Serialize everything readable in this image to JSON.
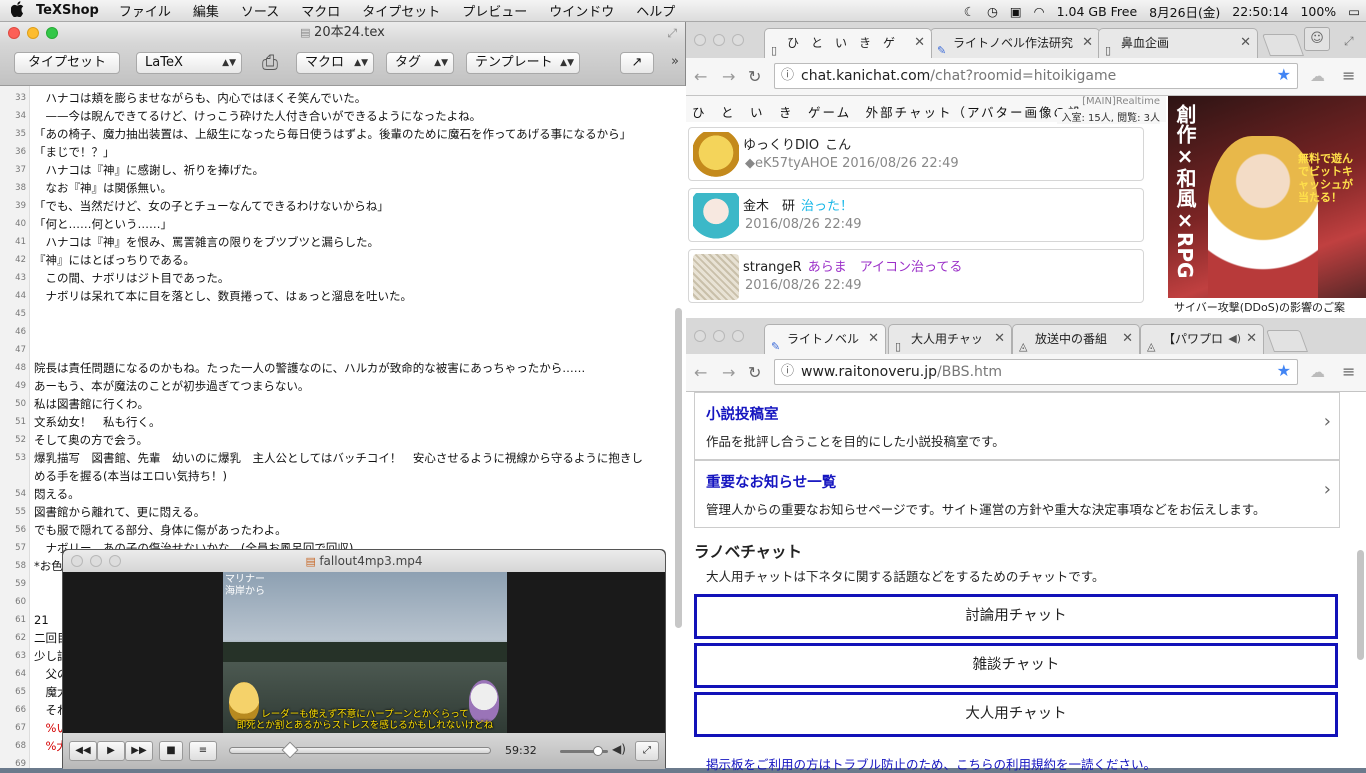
{
  "menubar": {
    "app_name": "TeXShop",
    "items": [
      "ファイル",
      "編集",
      "ソース",
      "マクロ",
      "タイプセット",
      "プレビュー",
      "ウインドウ",
      "ヘルプ"
    ],
    "disk_free": "1.04 GB Free",
    "date": "8月26日(金)",
    "time": "22:50:14",
    "battery": "100%"
  },
  "texshop": {
    "window_title": "20本24.tex",
    "toolbar": {
      "typeset_label": "タイプセット",
      "engine_value": "LaTeX",
      "macro_label": "マクロ",
      "tag_label": "タグ",
      "template_label": "テンプレート"
    },
    "lines": [
      {
        "num": "33",
        "text": "　ハナコは頬を膨らませながらも、内心ではほくそ笑んでいた。"
      },
      {
        "num": "34",
        "text": "　——今は睨んできてるけど、けっこう砕けた人付き合いができるようになったよね。"
      },
      {
        "num": "35",
        "text": "「あの椅子、魔力抽出装置は、上級生になったら毎日使うはずよ。後輩のために魔石を作ってあげる事になるから」"
      },
      {
        "num": "36",
        "text": "「まじで！？」"
      },
      {
        "num": "37",
        "text": "　ハナコは『神』に感謝し、祈りを捧げた。"
      },
      {
        "num": "38",
        "text": "　なお『神』は関係無い。"
      },
      {
        "num": "39",
        "text": "「でも、当然だけど、女の子とチューなんてできるわけないからね」"
      },
      {
        "num": "40",
        "text": "「何と……何という……」"
      },
      {
        "num": "41",
        "text": "　ハナコは『神』を恨み、罵詈雑言の限りをブツブツと漏らした。"
      },
      {
        "num": "42",
        "text": "『神』にはとばっちりである。"
      },
      {
        "num": "43",
        "text": "　この間、ナボリはジト目であった。"
      },
      {
        "num": "44",
        "text": "　ナボリは呆れて本に目を落とし、数頁捲って、はぁっと溜息を吐いた。"
      },
      {
        "num": "45",
        "text": ""
      },
      {
        "num": "46",
        "text": ""
      },
      {
        "num": "47",
        "text": ""
      },
      {
        "num": "48",
        "text": "院長は責任問題になるのかもね。たった一人の警護なのに、ハルカが致命的な被害にあっちゃったから……"
      },
      {
        "num": "49",
        "text": "あーもう、本が魔法のことが初歩過ぎてつまらない。"
      },
      {
        "num": "50",
        "text": "私は図書館に行くわ。"
      },
      {
        "num": "51",
        "text": "文系幼女！　私も行く。"
      },
      {
        "num": "52",
        "text": "そして奥の方で会う。"
      },
      {
        "num": "53",
        "text": "爆乳描写　図書館、先輩　幼いのに爆乳　主人公としてはバッチコイ！　安心させるように視線から守るように抱きし"
      },
      {
        "num": "",
        "text": "める手を握る(本当はエロい気持ち！)"
      },
      {
        "num": "54",
        "text": "悶える。"
      },
      {
        "num": "55",
        "text": "図書館から離れて、更に悶える。"
      },
      {
        "num": "56",
        "text": "でも服で隠れてる部分、身体に傷があったわよ。"
      },
      {
        "num": "57",
        "text": "　ナボリー。あの子の傷治せないかな。(全員お風呂回で回収)"
      },
      {
        "num": "58",
        "text": "*お色気を説明を一気にやる"
      },
      {
        "num": "59",
        "text": ""
      },
      {
        "num": "60",
        "text": ""
      },
      {
        "num": "61",
        "text": "21"
      },
      {
        "num": "62",
        "text": "二回目"
      },
      {
        "num": "63",
        "text": "少し話"
      },
      {
        "num": "64",
        "text": "　父の"
      },
      {
        "num": "65",
        "text": "　魔大"
      },
      {
        "num": "66",
        "text": "　それ"
      },
      {
        "num": "67",
        "text": "　%い",
        "red": true
      },
      {
        "num": "68",
        "text": "　%大",
        "red": true
      },
      {
        "num": "69",
        "text": ""
      },
      {
        "num": "70",
        "text": "魔物"
      }
    ]
  },
  "player": {
    "title": "fallout4mp3.mp4",
    "overlay_top": "マリナー海岸から",
    "subtitle_1": "レーダーも使えず不意にハープーンとかぐらって",
    "subtitle_2": "即死とか割とあるからストレスを感じるかもしれないけどね",
    "position": 0.23,
    "time": "59:32",
    "volume": 0.8
  },
  "chat_window": {
    "tabs": [
      {
        "label": "ひ　と　い　き　ゲ",
        "active": true
      },
      {
        "label": "ライトノベル作法研究",
        "active": false
      },
      {
        "label": "鼻血企画",
        "active": false
      }
    ],
    "url_host": "chat.kanichat.com",
    "url_path": "/chat?roomid=hitoikigame",
    "header_title": "ひ　と　い　き　ゲーム　外部チャット（アバター画像の設",
    "header_room": "[MAIN]Realtime",
    "header_count": "入室: 15人, 閲覧: 3人",
    "messages": [
      {
        "name": "ゆっくりDIO",
        "text": "こん",
        "text_color": "#222222",
        "meta": "◆eK57tyAHOE 2016/08/26 22:49"
      },
      {
        "name": "金木　研",
        "text": "治った！",
        "text_color": "#1ab8e8",
        "meta": "2016/08/26 22:49"
      },
      {
        "name": "strangeR",
        "text": "あらま　アイコン治ってる",
        "text_color": "#9b30c8",
        "meta": "2016/08/26 22:49"
      }
    ],
    "ad_title": "創作×和風×RPG",
    "ad_sub": "無料で遊んでビットキャッシュが当たる！",
    "news_snippet": "サイバー攻撃(DDoS)の影響のご案"
  },
  "novel_window": {
    "tabs": [
      {
        "label": "ライトノベル",
        "active": true
      },
      {
        "label": "大人用チャッ",
        "active": false
      },
      {
        "label": "放送中の番組",
        "active": false
      },
      {
        "label": "【パワプロ",
        "active": false
      }
    ],
    "url_host": "www.raitonoveru.jp",
    "url_path": "/BBS.htm",
    "cards": [
      {
        "title": "小説投稿室",
        "desc": "作品を批評し合うことを目的にした小説投稿室です。"
      },
      {
        "title": "重要なお知らせ一覧",
        "desc": "管理人からの重要なお知らせページです。サイト運営の方針や重大な決定事項などをお伝えします。"
      }
    ],
    "section_title": "ラノベチャット",
    "section_desc": "大人用チャットは下ネタに関する話題などをするためのチャットです。",
    "buttons": [
      "討論用チャット",
      "雑談チャット",
      "大人用チャット"
    ],
    "footer_notice": "掲示板をご利用の方はトラブル防止のため、こちらの利用規約を一読ください。"
  },
  "colors": {
    "link_blue": "#1515c0",
    "button_border": "#1212b8",
    "chrome_star": "#4285f4"
  }
}
